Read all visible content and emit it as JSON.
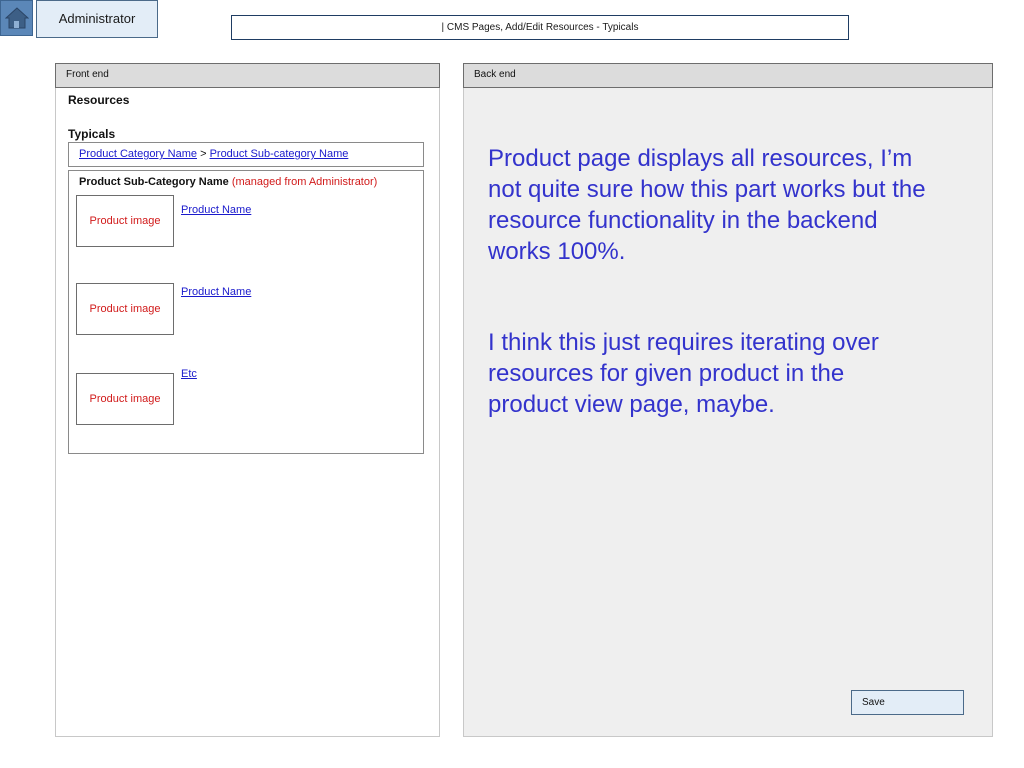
{
  "header": {
    "role_tab": "Administrator",
    "page_title": "| CMS Pages, Add/Edit Resources - Typicals"
  },
  "front_end": {
    "header": "Front end",
    "resources_title": "Resources",
    "typicals_title": "Typicals",
    "breadcrumb": {
      "category": "Product Category Name",
      "separator": ">",
      "subcategory": "Product Sub-category Name"
    },
    "subcategory_box": {
      "title": "Product Sub-Category Name",
      "managed_note": "(managed from Administrator)",
      "items": [
        {
          "image_label": "Product image",
          "link": "Product Name"
        },
        {
          "image_label": "Product image",
          "link": "Product Name"
        },
        {
          "image_label": "Product image",
          "link": "Etc"
        }
      ]
    }
  },
  "back_end": {
    "header": "Back end",
    "note_1": "Product page displays all resources, I’m not quite sure how this part works but the resource functionality in the backend works 100%.",
    "note_2": "I think this just requires iterating over resources for given product in the product view page, maybe.",
    "save_label": "Save"
  },
  "colors": {
    "note_text": "#3333cc",
    "placeholder_red": "#d11a1a",
    "link_blue": "#1a1acc"
  }
}
